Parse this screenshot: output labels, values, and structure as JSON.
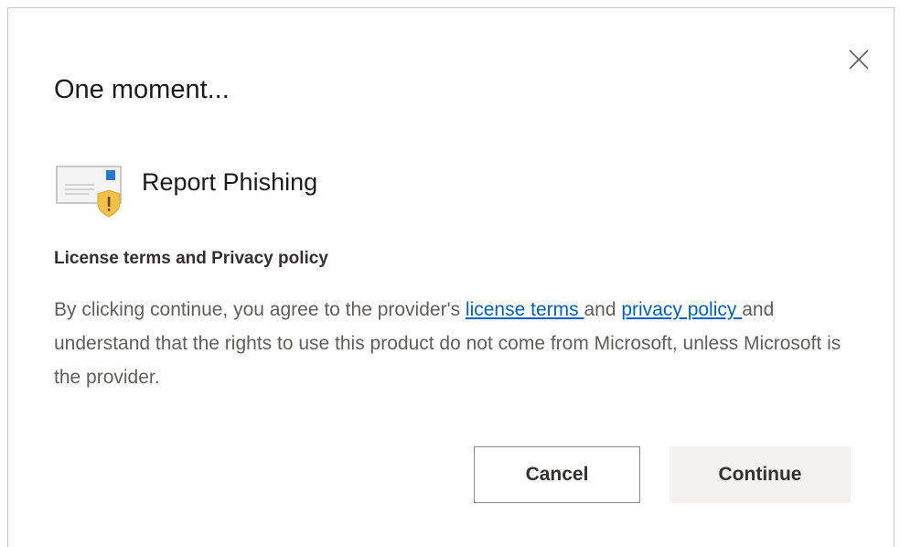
{
  "dialog": {
    "title": "One moment...",
    "addin_name": "Report Phishing",
    "section_heading": "License terms and Privacy policy",
    "body": {
      "before_license": "By clicking continue, you agree to the provider's ",
      "license_link": "license terms ",
      "between": "and ",
      "privacy_link": "privacy policy ",
      "after_privacy": "and understand that the rights to use this product do not come from Microsoft, unless Microsoft is the provider."
    },
    "cancel_label": "Cancel",
    "continue_label": "Continue",
    "icons": {
      "close": "close-icon",
      "addin": "report-phishing-icon"
    },
    "colors": {
      "link": "#0063c4",
      "title_text": "#1b1b1b",
      "body_text": "#605e5c",
      "continue_bg": "#f3f2f1",
      "warning_shield": "#f2c14b"
    }
  }
}
